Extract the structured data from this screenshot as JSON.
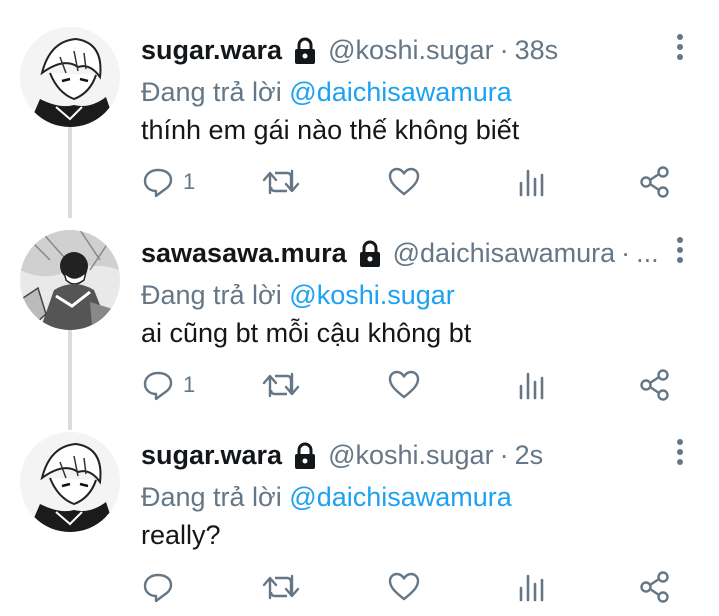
{
  "colors": {
    "text": "#14171a",
    "muted": "#657786",
    "link": "#1da1f2",
    "line": "#d9dde0"
  },
  "icons": {
    "verified_lock": "lock-icon",
    "more": "more-vertical-icon",
    "reply": "reply-icon",
    "retweet": "retweet-icon",
    "like": "heart-icon",
    "analytics": "analytics-icon",
    "share": "share-icon"
  },
  "tweets": [
    {
      "display_name": "sugar.wara",
      "handle": "@koshi.sugar",
      "separator": "·",
      "time": "38s",
      "reply_prefix": "Đang trả lời",
      "reply_mention": "@daichisawamura",
      "text": "thính em gái nào thế không biết",
      "reply_count": "1"
    },
    {
      "display_name": "sawasawa.mura",
      "handle": "@daichisawamura",
      "separator": "·",
      "time": "...",
      "reply_prefix": "Đang trả lời",
      "reply_mention": "@koshi.sugar",
      "text": "ai cũng bt mỗi cậu không bt",
      "reply_count": "1"
    },
    {
      "display_name": "sugar.wara",
      "handle": "@koshi.sugar",
      "separator": "·",
      "time": "2s",
      "reply_prefix": "Đang trả lời",
      "reply_mention": "@daichisawamura",
      "text": "really?",
      "reply_count": ""
    }
  ]
}
